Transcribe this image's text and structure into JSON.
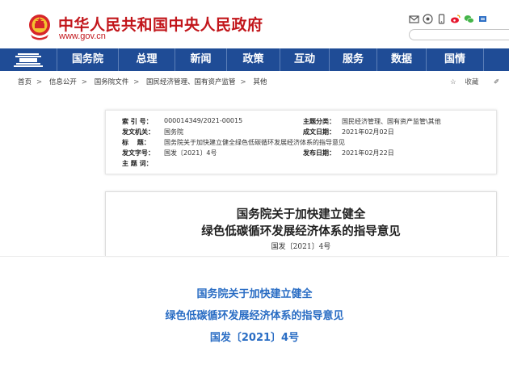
{
  "header": {
    "site_title": "中华人民共和国中央人民政府",
    "site_url": "www.gov.cn",
    "icons": [
      "mail-icon",
      "weibo-circle-icon",
      "mobile-icon",
      "weibo-icon",
      "wechat-icon",
      "more-icon"
    ]
  },
  "nav": {
    "items": [
      "国务院",
      "总理",
      "新闻",
      "政策",
      "互动",
      "服务",
      "数据",
      "国情"
    ]
  },
  "breadcrumb": {
    "items": [
      "首页",
      "信息公开",
      "国务院文件",
      "国民经济管理、国有资产监管",
      "其他"
    ],
    "separator": ">",
    "favorite_label": "收藏",
    "edit_label": "✐"
  },
  "meta": {
    "index_label": "索 引 号：",
    "index_value": "000014349/2021-00015",
    "category_label": "主题分类：",
    "category_value": "国民经济管理、国有资产监管\\其他",
    "issuer_label": "发文机关：",
    "issuer_value": "国务院",
    "created_label": "成文日期：",
    "created_value": "2021年02月02日",
    "title_label": "标　 题：",
    "title_value": "国务院关于加快建立健全绿色低碳循环发展经济体系的指导意见",
    "docno_label": "发文字号：",
    "docno_value": "国发〔2021〕4号",
    "published_label": "发布日期：",
    "published_value": "2021年02月22日",
    "subject_label": "主 题 词：",
    "subject_value": ""
  },
  "document": {
    "title_line1": "国务院关于加快建立健全",
    "title_line2": "绿色低碳循环发展经济体系的指导意见",
    "doc_number": "国发〔2021〕4号"
  },
  "caption": {
    "line1": "国务院关于加快建立健全",
    "line2": "绿色低碳循环发展经济体系的指导意见",
    "line3": "国发〔2021〕4号"
  },
  "colors": {
    "brand_red": "#c2161b",
    "nav_blue": "#1f4c96",
    "caption_blue": "#2a6dc4"
  }
}
